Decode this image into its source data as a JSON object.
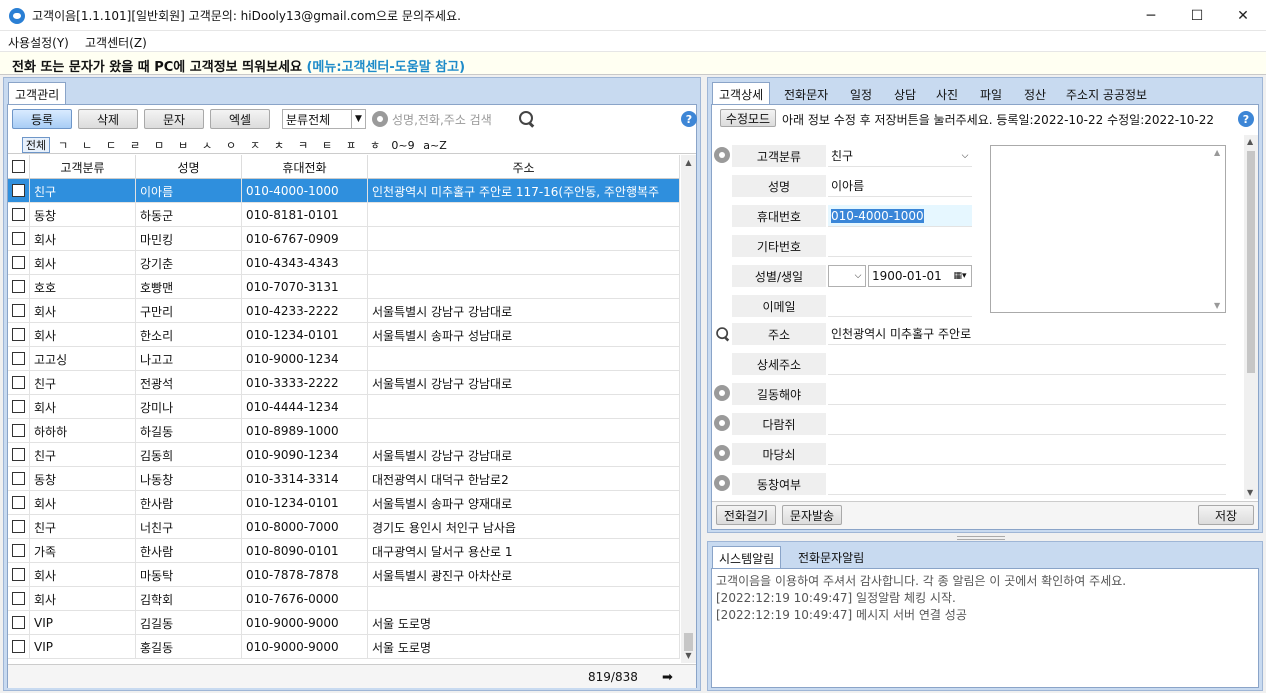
{
  "window": {
    "title": "고객이음[1.1.101][일반회원] 고객문의: hiDooly13@gmail.com으로 문의주세요.",
    "minimize": "─",
    "maximize": "☐",
    "close": "✕"
  },
  "menu": {
    "settings": "사용설정(Y)",
    "support": "고객센터(Z)"
  },
  "notice": {
    "main": "전화 또는 문자가 왔을 때 PC에 고객정보 띄워보세요",
    "hint": "(메뉴:고객센터-도움말 참고)"
  },
  "left": {
    "tab": "고객관리",
    "buttons": {
      "register": "등록",
      "delete": "삭제",
      "sms": "문자",
      "excel": "엑셀"
    },
    "category_filter": "분류전체",
    "search_placeholder": "성명,전화,주소 검색",
    "alpha": [
      "전체",
      "ㄱ",
      "ㄴ",
      "ㄷ",
      "ㄹ",
      "ㅁ",
      "ㅂ",
      "ㅅ",
      "ㅇ",
      "ㅈ",
      "ㅊ",
      "ㅋ",
      "ㅌ",
      "ㅍ",
      "ㅎ",
      "0~9",
      "a~Z"
    ],
    "columns": {
      "category": "고객분류",
      "name": "성명",
      "phone": "휴대전화",
      "address": "주소"
    },
    "rows": [
      {
        "category": "친구",
        "name": "이아름",
        "phone": "010-4000-1000",
        "address": "인천광역시 미추홀구 주안로 117-16(주안동, 주안행복주"
      },
      {
        "category": "동창",
        "name": "하동군",
        "phone": "010-8181-0101",
        "address": ""
      },
      {
        "category": "회사",
        "name": "마민킹",
        "phone": "010-6767-0909",
        "address": ""
      },
      {
        "category": "회사",
        "name": "강기춘",
        "phone": "010-4343-4343",
        "address": ""
      },
      {
        "category": "호호",
        "name": "호빵맨",
        "phone": "010-7070-3131",
        "address": ""
      },
      {
        "category": "회사",
        "name": "구만리",
        "phone": "010-4233-2222",
        "address": "서울특별시 강남구 강남대로"
      },
      {
        "category": "회사",
        "name": "한소리",
        "phone": "010-1234-0101",
        "address": "서울특별시 송파구 성남대로"
      },
      {
        "category": "고고싱",
        "name": "나고고",
        "phone": "010-9000-1234",
        "address": ""
      },
      {
        "category": "친구",
        "name": "전광석",
        "phone": "010-3333-2222",
        "address": "서울특별시 강남구 강남대로"
      },
      {
        "category": "회사",
        "name": "강미나",
        "phone": "010-4444-1234",
        "address": ""
      },
      {
        "category": "하하하",
        "name": "하길동",
        "phone": "010-8989-1000",
        "address": ""
      },
      {
        "category": "친구",
        "name": "김동희",
        "phone": "010-9090-1234",
        "address": "서울특별시 강남구 강남대로"
      },
      {
        "category": "동창",
        "name": "나동창",
        "phone": "010-3314-3314",
        "address": "대전광역시 대덕구 한남로2"
      },
      {
        "category": "회사",
        "name": "한사람",
        "phone": "010-1234-0101",
        "address": "서울특별시 송파구 양재대로"
      },
      {
        "category": "친구",
        "name": "너친구",
        "phone": "010-8000-7000",
        "address": "경기도 용인시 처인구 남사읍"
      },
      {
        "category": "가족",
        "name": "한사람",
        "phone": "010-8090-0101",
        "address": "대구광역시 달서구 용산로 1"
      },
      {
        "category": "회사",
        "name": "마동탁",
        "phone": "010-7878-7878",
        "address": "서울특별시 광진구 아차산로"
      },
      {
        "category": "회사",
        "name": "김학회",
        "phone": "010-7676-0000",
        "address": ""
      },
      {
        "category": "VIP",
        "name": "김길동",
        "phone": "010-9000-9000",
        "address": "서울 도로명"
      },
      {
        "category": "VIP",
        "name": "홍길동",
        "phone": "010-9000-9000",
        "address": "서울 도로명"
      }
    ],
    "record_count": "819/838"
  },
  "right": {
    "tabs": [
      "고객상세",
      "전화문자",
      "일정",
      "상담",
      "사진",
      "파일",
      "정산",
      "주소지 공공정보"
    ],
    "edit_mode_button": "수정모드",
    "edit_hint": "아래 정보 수정 후 저장버튼을 눌러주세요. 등록일:2022-10-22 수정일:2022-10-22",
    "fields": {
      "category_label": "고객분류",
      "category_value": "친구",
      "name_label": "성명",
      "name_value": "이아름",
      "mobile_label": "휴대번호",
      "mobile_value": "010-4000-1000",
      "other_label": "기타번호",
      "other_value": "",
      "gender_birth_label": "성별/생일",
      "gender_value": "",
      "birth_value": "1900-01-01",
      "email_label": "이메일",
      "email_value": "",
      "address_label": "주소",
      "address_value": "인천광역시 미추홀구 주안로",
      "detail_address_label": "상세주소",
      "detail_address_value": "",
      "custom1_label": "길동해야",
      "custom2_label": "다람쥐",
      "custom3_label": "마당쇠",
      "custom4_label": "동창여부"
    },
    "call_button": "전화걸기",
    "sms_button": "문자발송",
    "save_button": "저장"
  },
  "alerts": {
    "tabs": [
      "시스템알림",
      "전화문자알림"
    ],
    "lines": [
      "고객이음을 이용하여 주셔서 감사합니다. 각 종 알림은 이 곳에서 확인하여 주세요.",
      "[2022:12:19 10:49:47] 일정알람 체킹 시작.",
      "[2022:12:19 10:49:47] 메시지 서버 연결 성공"
    ]
  },
  "colors": {
    "selected_row": "#2f8fdd",
    "panel_bg": "#c8daf0",
    "notice_hint": "#1e8bc9"
  }
}
